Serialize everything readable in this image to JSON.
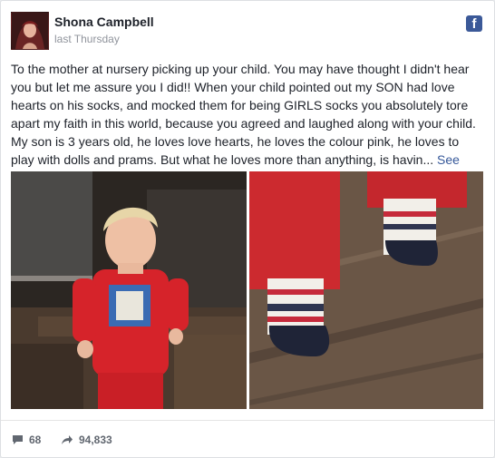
{
  "post": {
    "author": "Shona Campbell",
    "timestamp": "last Thursday",
    "text": "To the mother at nursery picking up your child. You may have thought I didn't hear you but let me assure you I did!! When your child pointed out my SON had love hearts on his socks, and mocked them for being GIRLS socks you absolutely tore apart my faith in this world, because you agreed and laughed along with your child. My son is 3 years old, he loves love hearts, he loves the colour pink, he loves to play with dolls and prams. But what he loves more than anything, is havin...",
    "see_more": "See more",
    "photos": [
      "child-red-outfit-photo",
      "heart-socks-feet-photo"
    ]
  },
  "brand": {
    "icon": "facebook-icon",
    "logo_letter": "f",
    "color": "#3b5998"
  },
  "footer": {
    "comment_icon": "comment-icon",
    "comments_count": "68",
    "share_icon": "share-icon",
    "shares_count": "94,833"
  },
  "colors": {
    "link": "#365899",
    "text": "#1d2129",
    "meta": "#90949c"
  }
}
